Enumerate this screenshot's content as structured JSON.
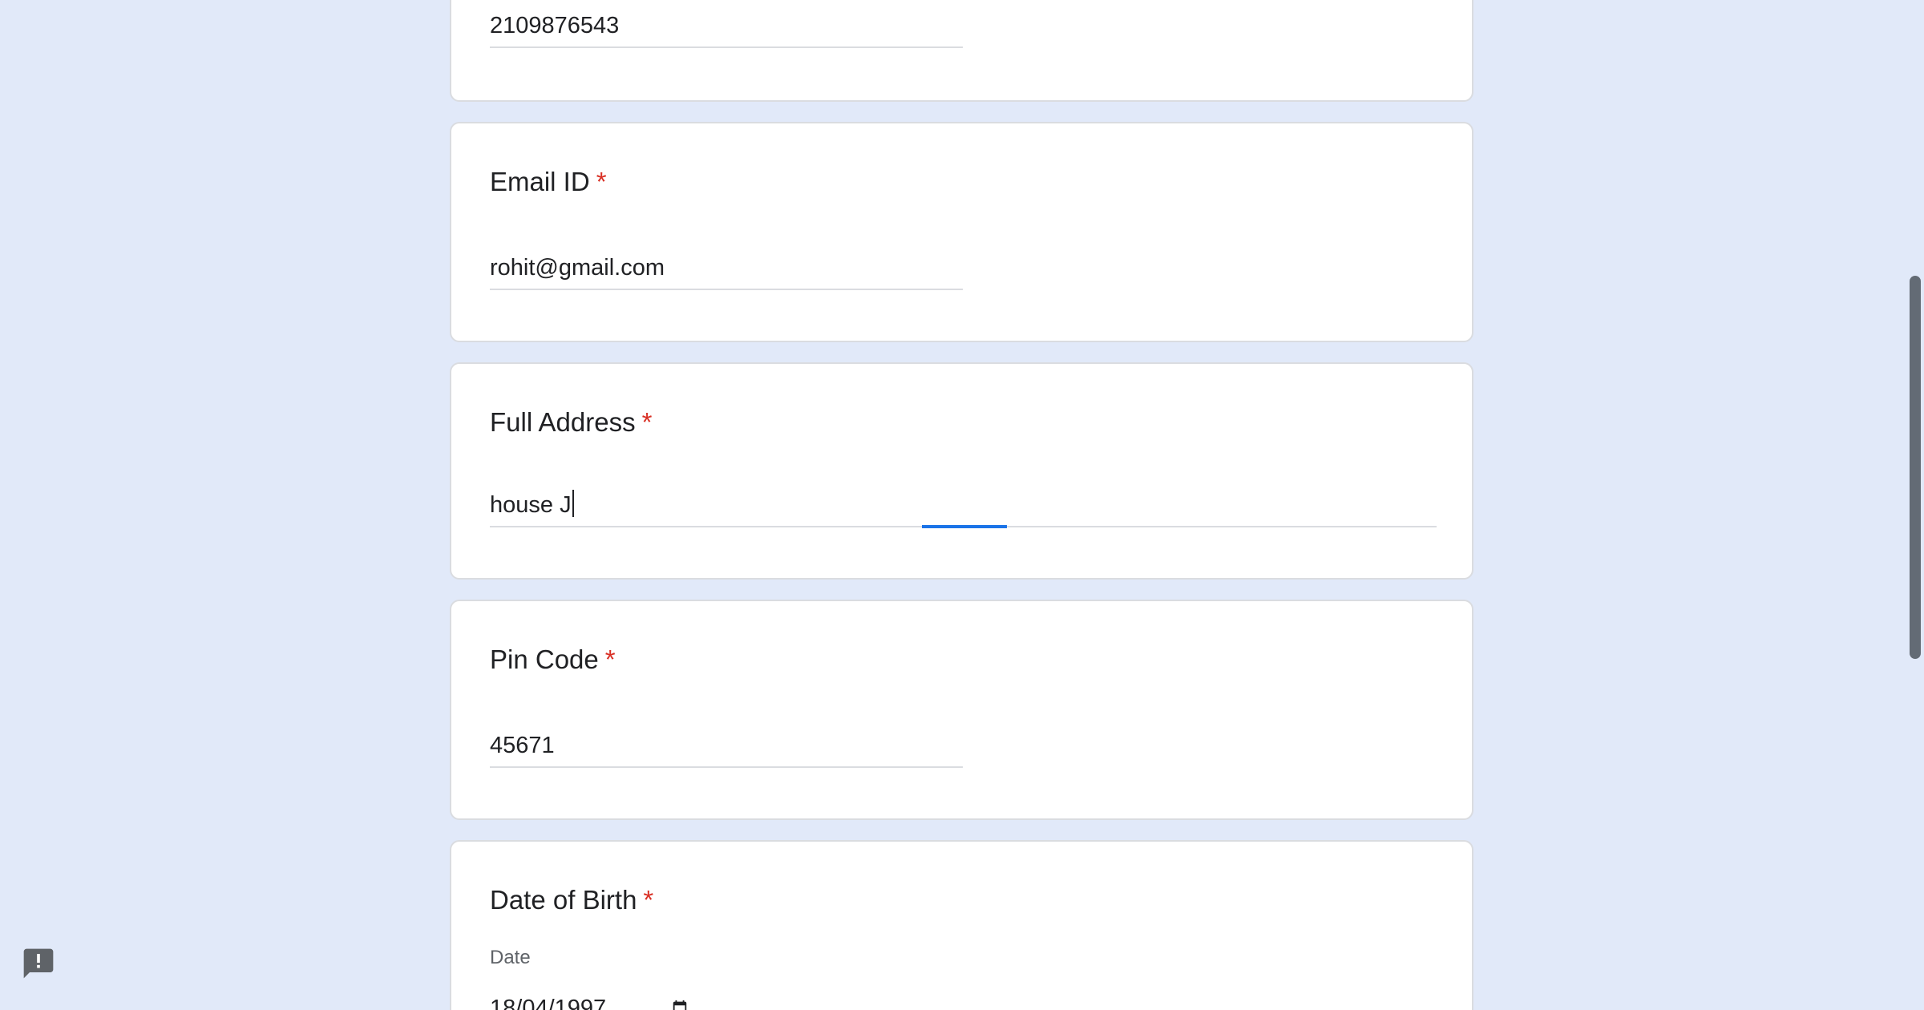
{
  "phone_card": {
    "answer": "2109876543"
  },
  "email_card": {
    "title": "Email ID",
    "required_mark": "*",
    "answer": "rohit@gmail.com"
  },
  "address_card": {
    "title": "Full Address",
    "required_mark": "*",
    "answer": "house J"
  },
  "pin_card": {
    "title": "Pin Code",
    "required_mark": "*",
    "answer": "45671"
  },
  "dob_card": {
    "title": "Date of Birth",
    "required_mark": "*",
    "sub_label": "Date",
    "answer": "18/04/1997"
  },
  "icons": {
    "calendar": "calendar-icon",
    "feedback": "report-problem-icon"
  },
  "colors": {
    "page_background": "#e1e9f9",
    "card_border": "#dadce0",
    "required": "#d93025",
    "focus_accent": "#1a73e8"
  }
}
